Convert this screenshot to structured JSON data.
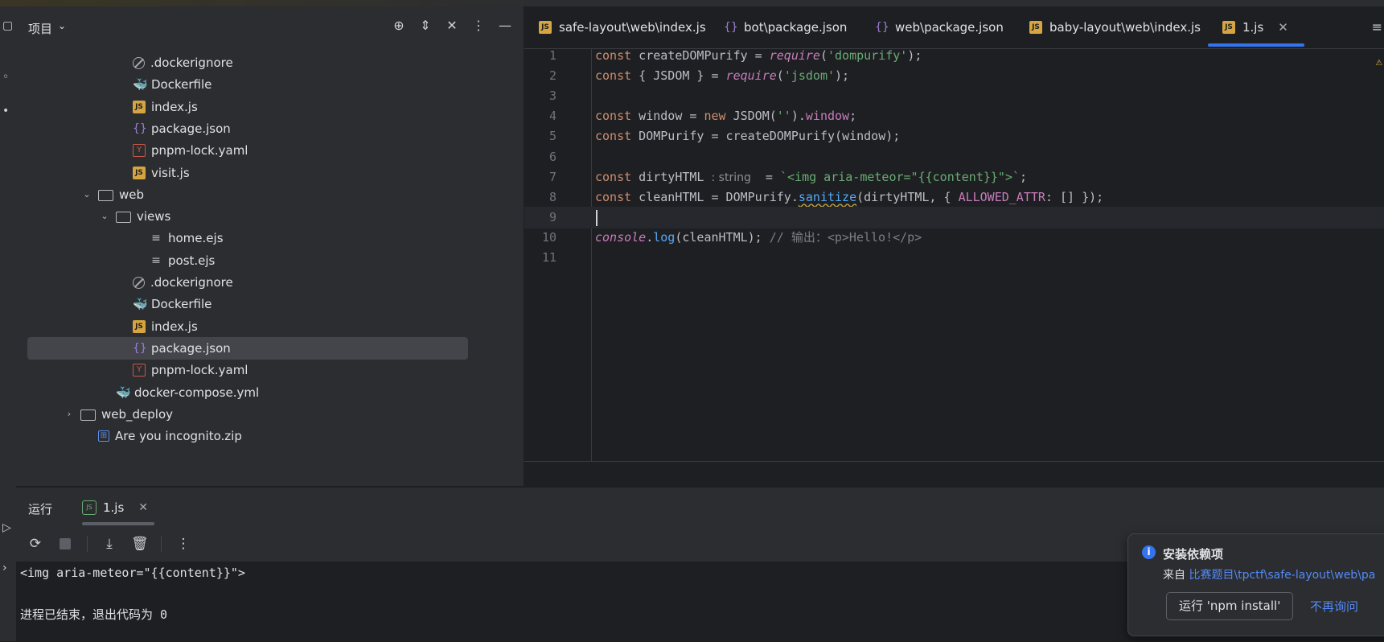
{
  "project": {
    "title": "项目",
    "tools": [
      "locate-icon",
      "expand-all-icon",
      "collapse-all-icon",
      "more-icon",
      "minimize-icon"
    ],
    "tree": [
      {
        "label": ".dockerignore",
        "icon": "ignore"
      },
      {
        "label": "Dockerfile",
        "icon": "docker"
      },
      {
        "label": "index.js",
        "icon": "js"
      },
      {
        "label": "package.json",
        "icon": "json"
      },
      {
        "label": "pnpm-lock.yaml",
        "icon": "yaml"
      },
      {
        "label": "visit.js",
        "icon": "js"
      },
      {
        "label": "web",
        "icon": "folder",
        "expanded": true
      },
      {
        "label": "views",
        "icon": "folder",
        "expanded": true
      },
      {
        "label": "home.ejs",
        "icon": "text"
      },
      {
        "label": "post.ejs",
        "icon": "text"
      },
      {
        "label": ".dockerignore",
        "icon": "ignore"
      },
      {
        "label": "Dockerfile",
        "icon": "docker"
      },
      {
        "label": "index.js",
        "icon": "js"
      },
      {
        "label": "package.json",
        "icon": "json",
        "selected": true
      },
      {
        "label": "pnpm-lock.yaml",
        "icon": "yaml"
      },
      {
        "label": "docker-compose.yml",
        "icon": "docker"
      },
      {
        "label": "web_deploy",
        "icon": "folder",
        "expanded": false
      },
      {
        "label": "Are you incognito.zip",
        "icon": "zip"
      }
    ]
  },
  "tabs": [
    {
      "label": "safe-layout\\web\\index.js",
      "icon": "js"
    },
    {
      "label": "bot\\package.json",
      "icon": "json"
    },
    {
      "label": "web\\package.json",
      "icon": "json"
    },
    {
      "label": "baby-layout\\web\\index.js",
      "icon": "js"
    },
    {
      "label": "1.js",
      "icon": "js",
      "active": true
    }
  ],
  "editor": {
    "lines": [
      {
        "n": "1",
        "code": "const createDOMPurify = require('dompurify');"
      },
      {
        "n": "2",
        "code": "const { JSDOM } = require('jsdom');"
      },
      {
        "n": "3",
        "code": ""
      },
      {
        "n": "4",
        "code": "const window = new JSDOM('').window;"
      },
      {
        "n": "5",
        "code": "const DOMPurify = createDOMPurify(window);"
      },
      {
        "n": "6",
        "code": ""
      },
      {
        "n": "7",
        "code": "const dirtyHTML = `<img aria-meteor=\"{{content}}\">`;",
        "hint": ": string"
      },
      {
        "n": "8",
        "code": "const cleanHTML = DOMPurify.sanitize(dirtyHTML, { ALLOWED_ATTR: [] });"
      },
      {
        "n": "9",
        "code": "",
        "current": true
      },
      {
        "n": "10",
        "code": "console.log(cleanHTML); // 输出：<p>Hello!</p>"
      },
      {
        "n": "11",
        "code": ""
      }
    ]
  },
  "run": {
    "title": "运行",
    "tab_label": "1.js",
    "tools": [
      "rerun-icon",
      "stop-icon",
      "scroll-to-end-icon",
      "clear-icon",
      "more-icon"
    ],
    "output": [
      "<img aria-meteor=\"{{content}}\">",
      "",
      "进程已结束，退出代码为 0"
    ]
  },
  "notification": {
    "title": "安装依赖项",
    "body_prefix": "来自 ",
    "body_link": "比赛题目\\tpctf\\safe-layout\\web\\pa",
    "button": "运行 'npm install'",
    "dismiss": "不再询问"
  },
  "colors": {
    "accent": "#3574f0",
    "keyword": "#cf8e6d",
    "string": "#6aab73",
    "link": "#548af7"
  }
}
